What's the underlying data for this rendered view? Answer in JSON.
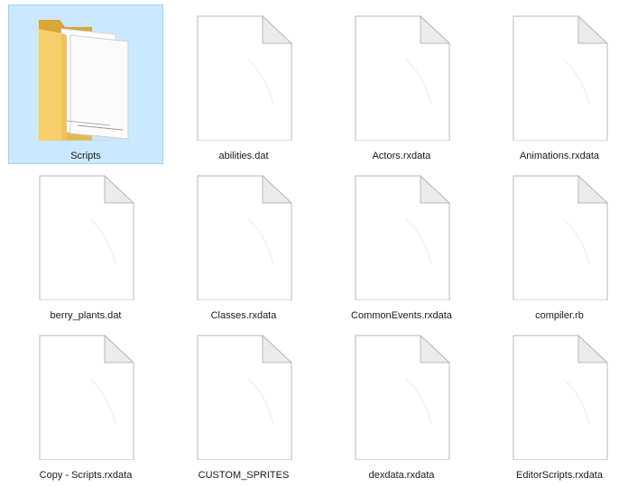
{
  "explorer": {
    "view": "large-icons",
    "selection_color": "#cce8ff",
    "selection_border_color": "#99d1ff",
    "items": [
      {
        "name": "Scripts",
        "type": "folder",
        "icon": "folder-icon",
        "selected": true
      },
      {
        "name": "abilities.dat",
        "type": "file",
        "icon": "document-icon",
        "selected": false
      },
      {
        "name": "Actors.rxdata",
        "type": "file",
        "icon": "document-icon",
        "selected": false
      },
      {
        "name": "Animations.rxdata",
        "type": "file",
        "icon": "document-icon",
        "selected": false
      },
      {
        "name": "berry_plants.dat",
        "type": "file",
        "icon": "document-icon",
        "selected": false
      },
      {
        "name": "Classes.rxdata",
        "type": "file",
        "icon": "document-icon",
        "selected": false
      },
      {
        "name": "CommonEvents.rxdata",
        "type": "file",
        "icon": "document-icon",
        "selected": false
      },
      {
        "name": "compiler.rb",
        "type": "file",
        "icon": "document-icon",
        "selected": false
      },
      {
        "name": "Copy - Scripts.rxdata",
        "type": "file",
        "icon": "document-icon",
        "selected": false
      },
      {
        "name": "CUSTOM_SPRITES",
        "type": "file",
        "icon": "document-icon",
        "selected": false
      },
      {
        "name": "dexdata.rxdata",
        "type": "file",
        "icon": "document-icon",
        "selected": false
      },
      {
        "name": "EditorScripts.rxdata",
        "type": "file",
        "icon": "document-icon",
        "selected": false
      }
    ]
  }
}
